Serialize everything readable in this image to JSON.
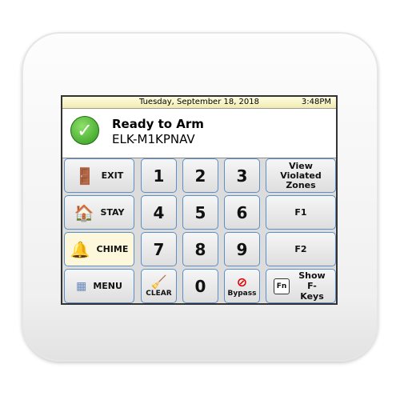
{
  "header": {
    "date": "Tuesday, September 18, 2018",
    "time": "3:48PM"
  },
  "status": {
    "icon": "check-icon",
    "title": "Ready to Arm",
    "device": "ELK-M1KPNAV"
  },
  "keys": {
    "exit": "EXIT",
    "stay": "STAY",
    "chime": "CHIME",
    "menu": "MENU",
    "clear": "CLEAR",
    "bypass": "Bypass",
    "view": "View Violated Zones",
    "f1": "F1",
    "f2": "F2",
    "fn": "Fn",
    "show": "Show F-Keys",
    "digits": [
      "1",
      "2",
      "3",
      "4",
      "5",
      "6",
      "7",
      "8",
      "9",
      "0"
    ]
  },
  "colors": {
    "button_border": "#5b8fc6",
    "chime_active": "#fdf8dc",
    "ready_green": "#2f9a1c"
  }
}
